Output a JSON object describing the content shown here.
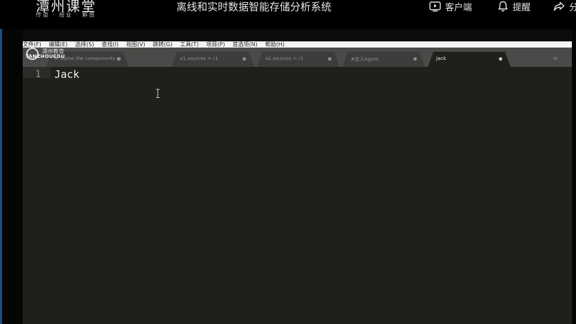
{
  "platform": {
    "brand_name": "潭州课堂",
    "brand_slogan": "传道 · 授业 · 解惑",
    "course_title": "离线和实时数据智能存储分析系统",
    "nav": {
      "client_label": "客户端",
      "remind_label": "提醒",
      "share_label": "分"
    }
  },
  "editor": {
    "menu": [
      "文件(F)",
      "编辑(E)",
      "选择(S)",
      "查找(I)",
      "视图(V)",
      "跳转(G)",
      "工具(T)",
      "项目(P)",
      "首选项(N)",
      "帮助(H)"
    ],
    "watermark": {
      "name": "潭州教育",
      "en": "TANZHOUEDU"
    },
    "tabs": [
      {
        "label": "# Name the components on this agent",
        "active": false
      },
      {
        "label": "a1.sources = r1",
        "active": false
      },
      {
        "label": "a1.sources = r1",
        "active": false
      },
      {
        "label": "#定义Agent",
        "active": false
      },
      {
        "label": "Jack",
        "active": true
      }
    ],
    "lines": [
      {
        "number": "1",
        "text": "Jack"
      }
    ]
  },
  "colors": {
    "editor_bg": "#1f201c",
    "tabbar_bg": "#4a4a48",
    "tab_bg": "#3c3c3a",
    "text": "#f3f3ee",
    "line_number": "#8f908a",
    "page_bg": "#050506"
  },
  "icons": {
    "client": "play-screen-icon",
    "remind": "bell-icon",
    "share": "share-arrow-icon",
    "tab_close": "dot-close-icon",
    "tab_dropdown": "chevron-down-icon",
    "cursor": "text-ibeam-cursor"
  }
}
